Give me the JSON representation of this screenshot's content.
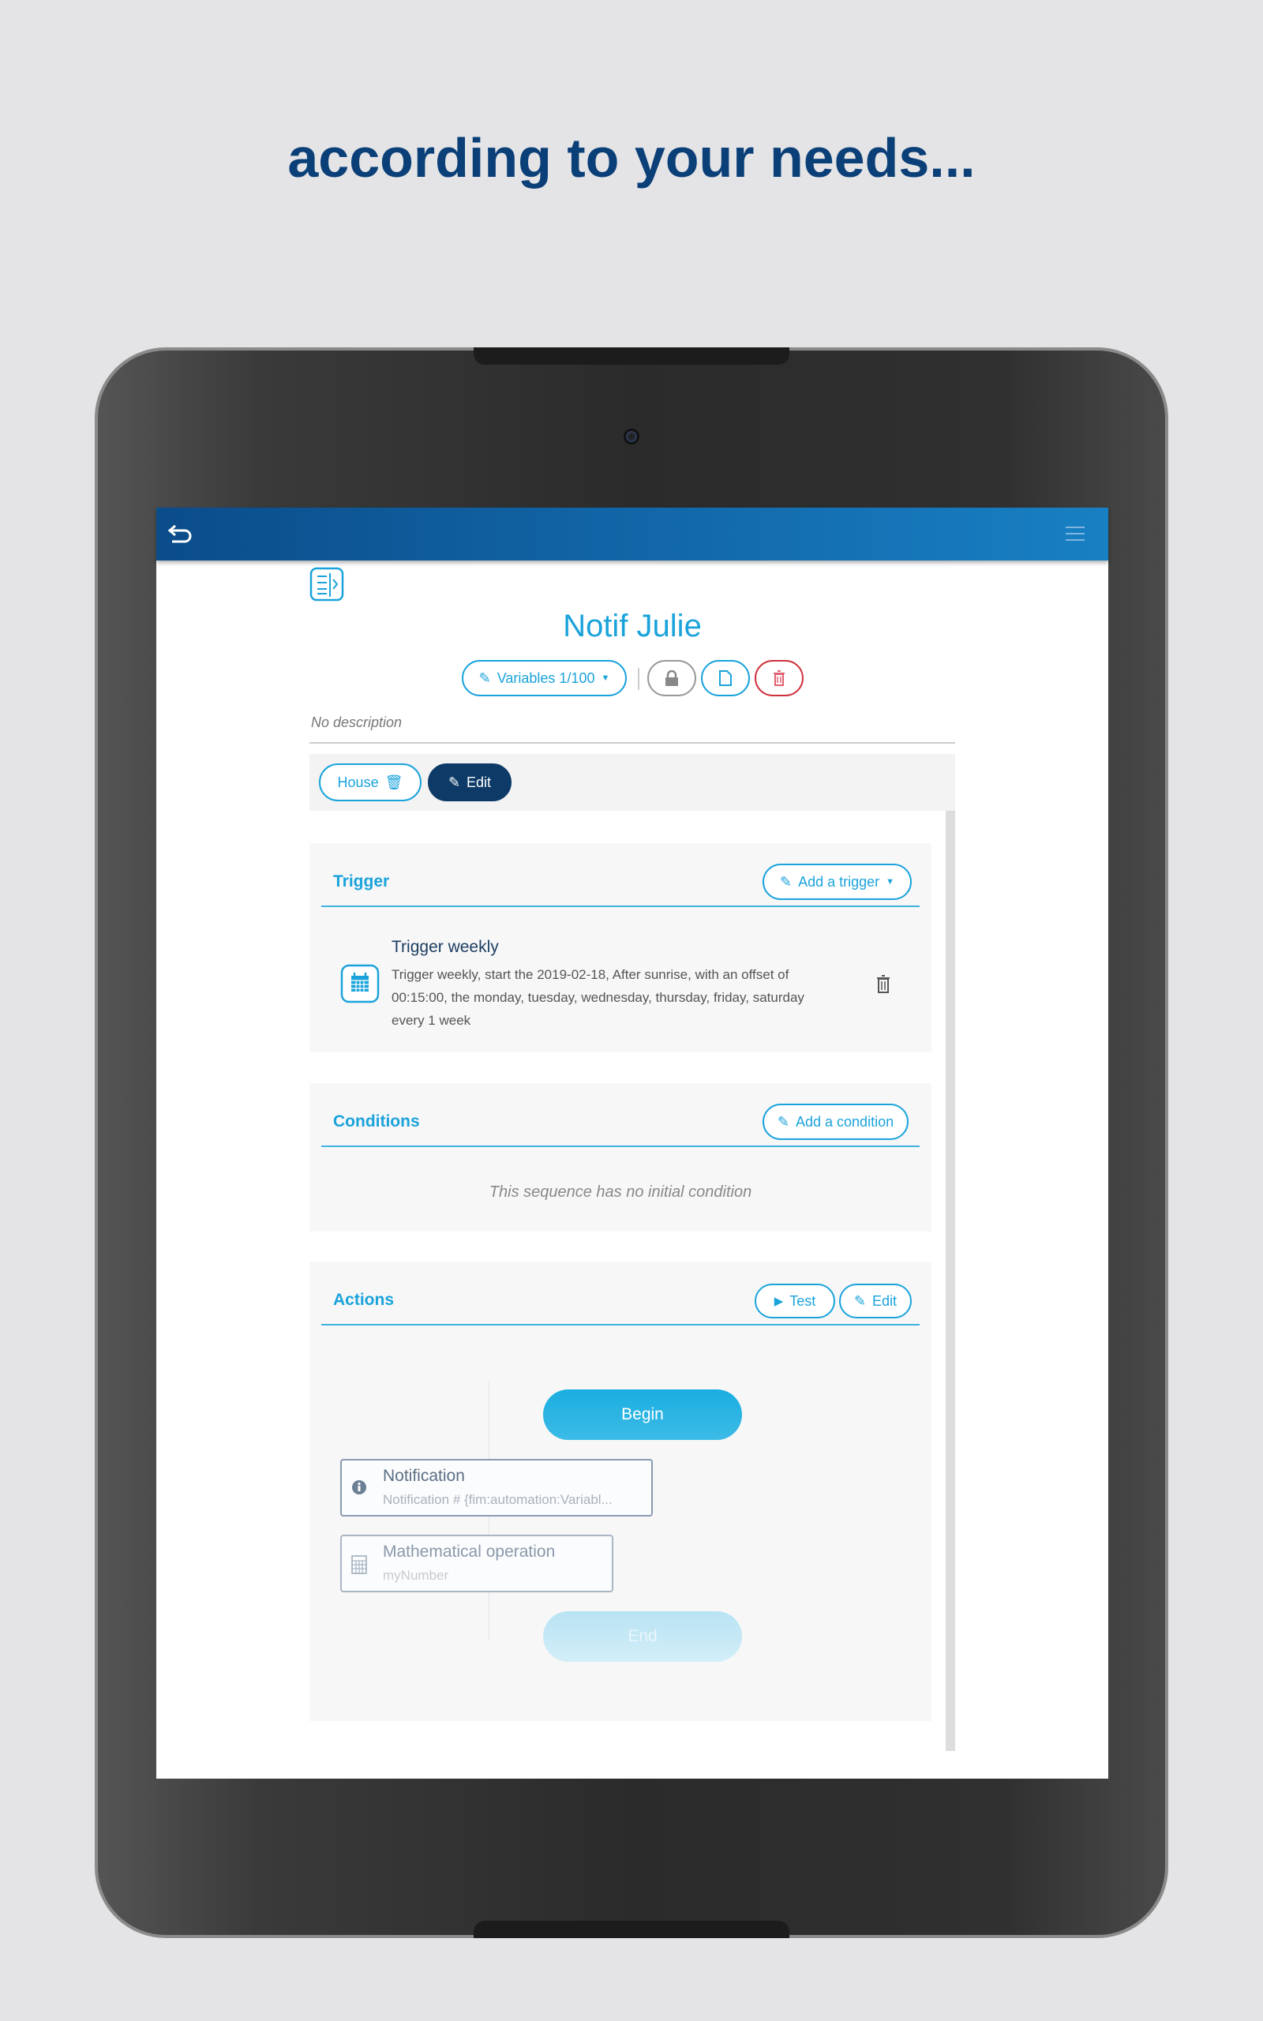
{
  "headline": "according to your needs...",
  "app": {
    "title": "Notif Julie",
    "variables_label": "Variables 1/100",
    "description": "No description",
    "tag_label": "House",
    "edit_label": "Edit",
    "trigger": {
      "heading": "Trigger",
      "add_label": "Add a trigger",
      "item_title": "Trigger weekly",
      "item_lines": [
        "Trigger weekly, start the 2019-02-18, After sunrise, with an offset of",
        "00:15:00, the monday, tuesday, wednesday, thursday, friday, saturday",
        "every 1 week"
      ]
    },
    "conditions": {
      "heading": "Conditions",
      "add_label": "Add a condition",
      "empty": "This sequence has no initial condition"
    },
    "actions": {
      "heading": "Actions",
      "test_label": "Test",
      "edit_label": "Edit",
      "begin": "Begin",
      "end": "End",
      "nodes": [
        {
          "title": "Notification",
          "subtitle": "Notification # {fim:automation:Variabl..."
        },
        {
          "title": "Mathematical operation",
          "subtitle": "myNumber"
        }
      ]
    }
  },
  "colors": {
    "accent": "#1aa3db",
    "header_dark": "#0b4c8a",
    "danger": "#d0303c",
    "edit_button": "#0d3a66",
    "headline": "#0a3f78"
  }
}
